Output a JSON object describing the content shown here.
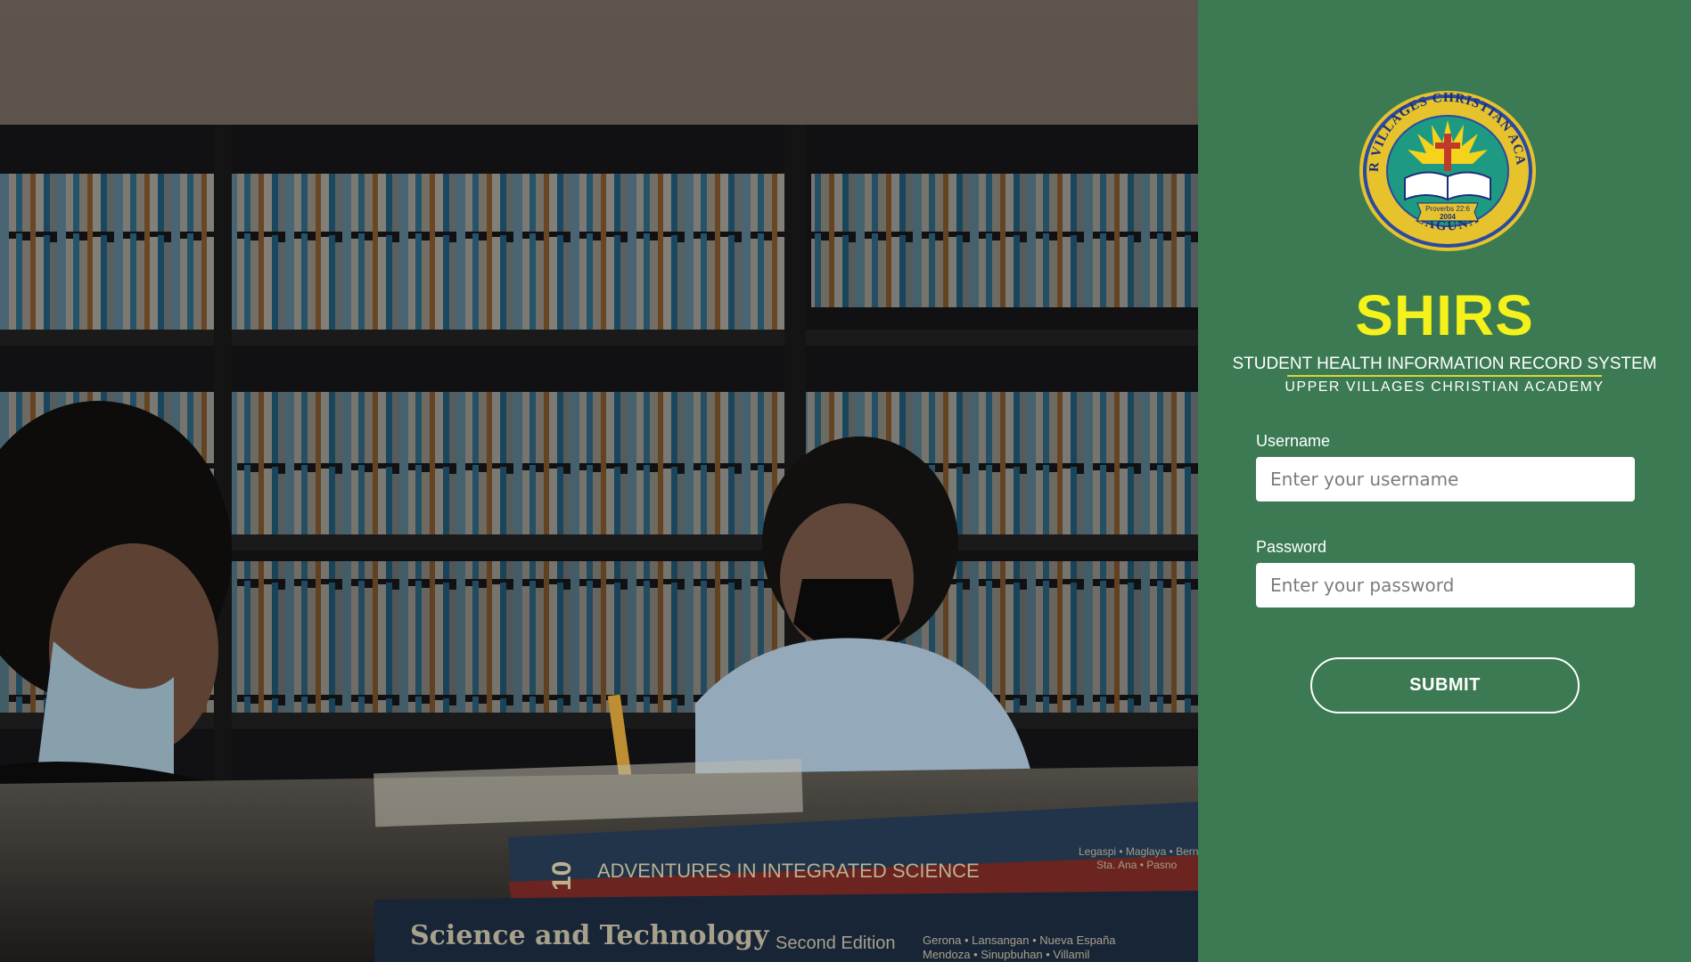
{
  "app": {
    "title": "SHIRS",
    "subtitle": "STUDENT HEALTH INFORMATION RECORD SYSTEM",
    "school": "UPPER VILLAGES CHRISTIAN ACADEMY"
  },
  "seal": {
    "ring_text": "UPPER VILLAGES CHRISTIAN ACADEMY",
    "location": "LAGUNA",
    "verse": "Proverbs 22:6",
    "year": "2004"
  },
  "form": {
    "username_label": "Username",
    "username_placeholder": "Enter your username",
    "username_value": "",
    "password_label": "Password",
    "password_placeholder": "Enter your password",
    "password_value": "",
    "submit_label": "SUBMIT"
  },
  "background_photo": {
    "book_title_1": "ADVENTURES IN INTEGRATED SCIENCE",
    "book_grade": "10",
    "book_title_2": "Science and Technology",
    "book_edition": "Second Edition",
    "book_authors": "Gerona • Lansangan • Nueva España",
    "book_authors_2": "Mendoza • Sinupbuhan • Villamil",
    "book1_authors": "Legaspi • Maglaya • Bernas",
    "book1_authors_2": "Sta. Ana • Pasno"
  },
  "colors": {
    "panel": "#3b7a53",
    "title": "#f4f21a",
    "accent_rule": "#d9d63a"
  }
}
